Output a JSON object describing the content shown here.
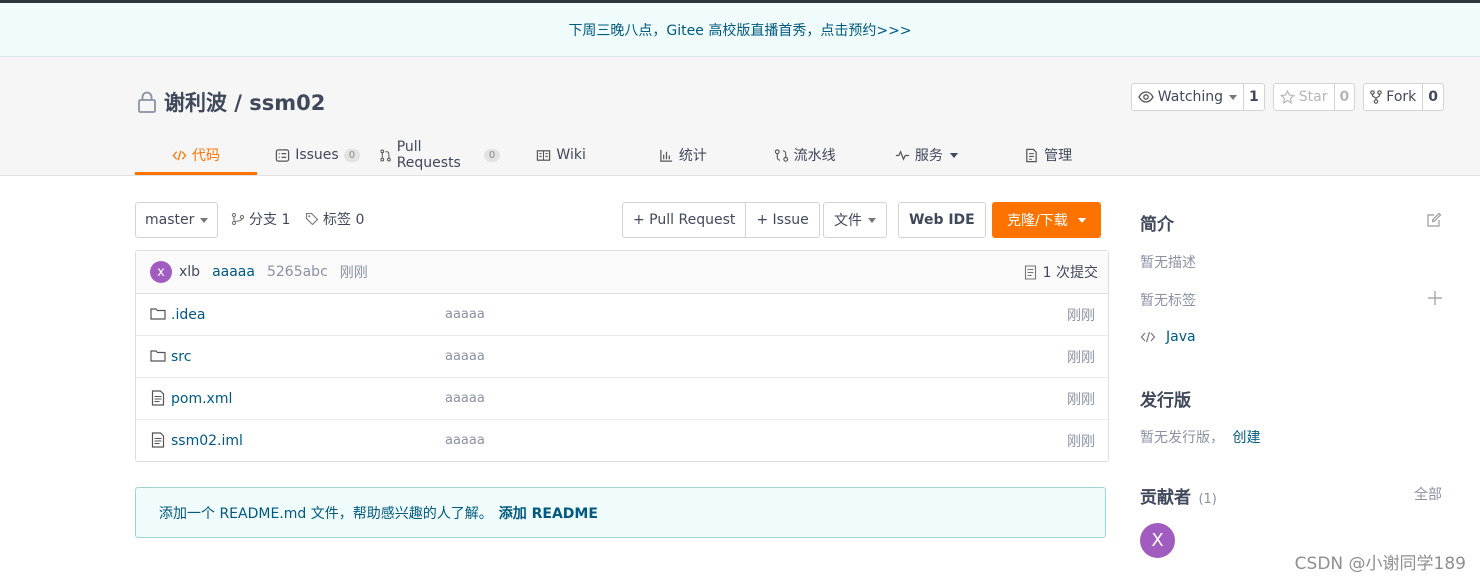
{
  "banner": {
    "text": "下周三晚八点，Gitee 高校版直播首秀，点击预约>>>"
  },
  "repo": {
    "title": "谢利波 / ssm02"
  },
  "actions": {
    "watch": {
      "label": "Watching",
      "count": "1"
    },
    "star": {
      "label": "Star",
      "count": "0"
    },
    "fork": {
      "label": "Fork",
      "count": "0"
    }
  },
  "tabs": [
    {
      "label": "代码",
      "icon": "code-icon",
      "active": true
    },
    {
      "label": "Issues",
      "icon": "issues-icon",
      "badge": "0"
    },
    {
      "label": "Pull Requests",
      "icon": "pull-request-icon",
      "badge": "0"
    },
    {
      "label": "Wiki",
      "icon": "book-icon"
    },
    {
      "label": "统计",
      "icon": "bar-chart-icon"
    },
    {
      "label": "流水线",
      "icon": "pipeline-icon"
    },
    {
      "label": "服务",
      "icon": "pulse-icon",
      "dropdown": true
    },
    {
      "label": "管理",
      "icon": "settings-doc-icon"
    }
  ],
  "toolbar": {
    "branch": "master",
    "branches_label": "分支 1",
    "tags_label": "标签 0",
    "pull_request": "+ Pull Request",
    "issue": "+ Issue",
    "file": "文件",
    "web_ide": "Web IDE",
    "clone": "克隆/下载"
  },
  "commit": {
    "avatar": "x",
    "author": "xlb",
    "message": "aaaaa",
    "sha": "5265abc",
    "time": "刚刚",
    "count": "1 次提交"
  },
  "files": [
    {
      "name": ".idea",
      "type": "folder",
      "message": "aaaaa",
      "time": "刚刚"
    },
    {
      "name": "src",
      "type": "folder",
      "message": "aaaaa",
      "time": "刚刚"
    },
    {
      "name": "pom.xml",
      "type": "file",
      "message": "aaaaa",
      "time": "刚刚"
    },
    {
      "name": "ssm02.iml",
      "type": "file",
      "message": "aaaaa",
      "time": "刚刚"
    }
  ],
  "readme": {
    "tip": "添加一个 README.md 文件，帮助感兴趣的人了解。",
    "link": "添加 README"
  },
  "sidebar": {
    "intro_title": "简介",
    "no_desc": "暂无描述",
    "no_tags": "暂无标签",
    "language": "Java",
    "release_title": "发行版",
    "no_release": "暂无发行版，",
    "create": "创建",
    "contrib_title": "贡献者",
    "contrib_count": "(1)",
    "all": "全部",
    "contrib_avatar": "X"
  },
  "watermark": "CSDN @小谢同学189",
  "colors": {
    "accent": "#fe7300",
    "link": "#005980",
    "avatar": "#a05cbf"
  }
}
